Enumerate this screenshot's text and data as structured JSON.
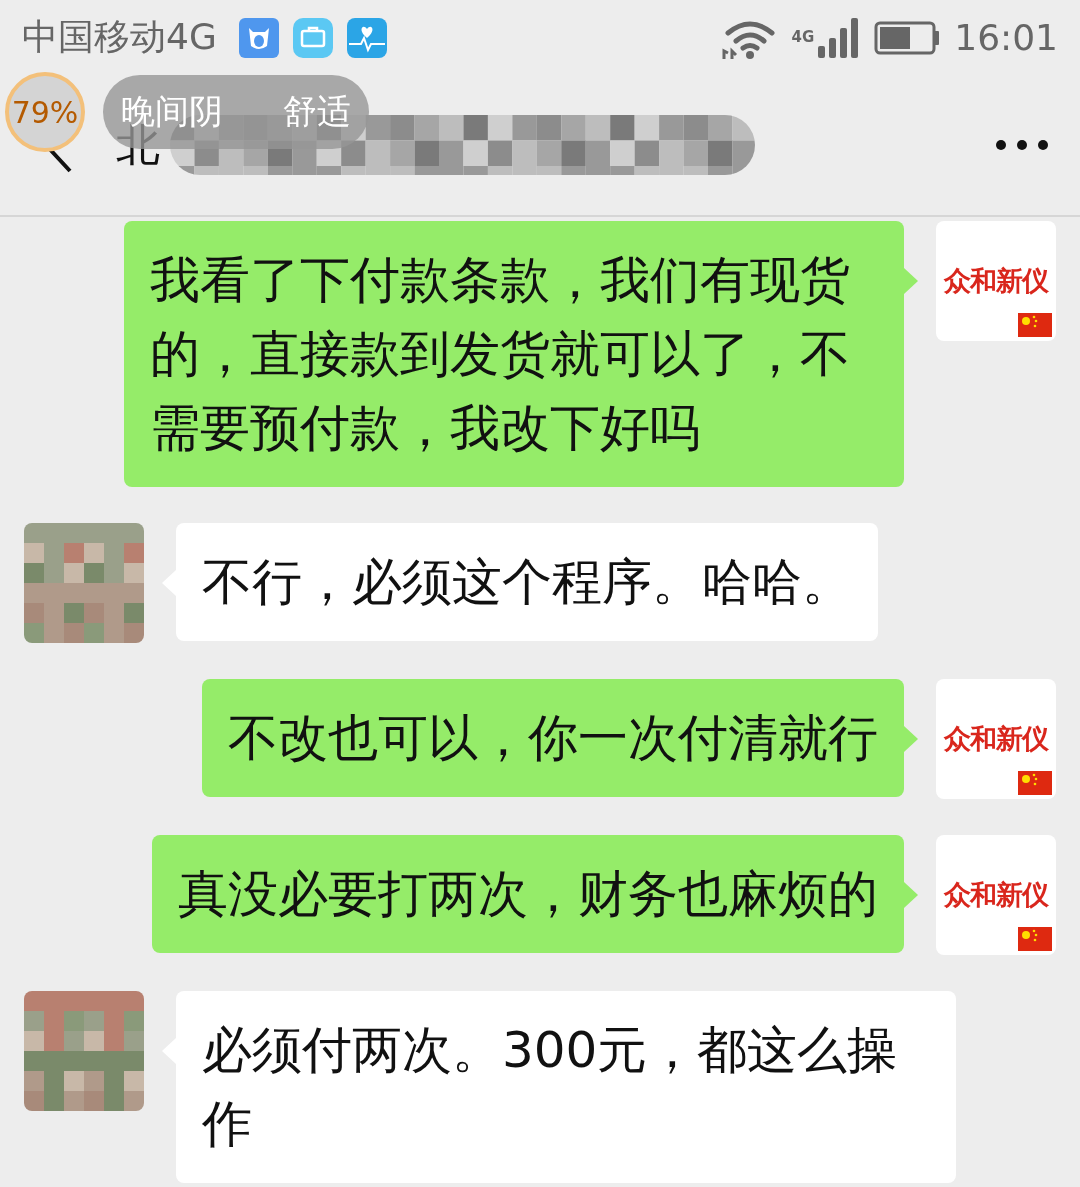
{
  "status_bar": {
    "carrier": "中国移动4G",
    "network_badge": "4G",
    "time": "16:01"
  },
  "weather_widget": {
    "percent": "79%",
    "texts": [
      "晚间阴",
      "舒适"
    ]
  },
  "header": {
    "title": "北"
  },
  "messages": [
    {
      "kind": "sent",
      "avatar_label": "众和新仪",
      "text": "我看了下付款条款，我们有现货的，直接款到发货就可以了，不需要预付款，我改下好吗"
    },
    {
      "kind": "received",
      "text": "不行，必须这个程序。哈哈。"
    },
    {
      "kind": "sent",
      "avatar_label": "众和新仪",
      "text": "不改也可以，你一次付清就行"
    },
    {
      "kind": "sent",
      "avatar_label": "众和新仪",
      "text": "真没必要打两次，财务也麻烦的"
    },
    {
      "kind": "received",
      "text": "必须付两次。300元，都这么操作"
    }
  ]
}
